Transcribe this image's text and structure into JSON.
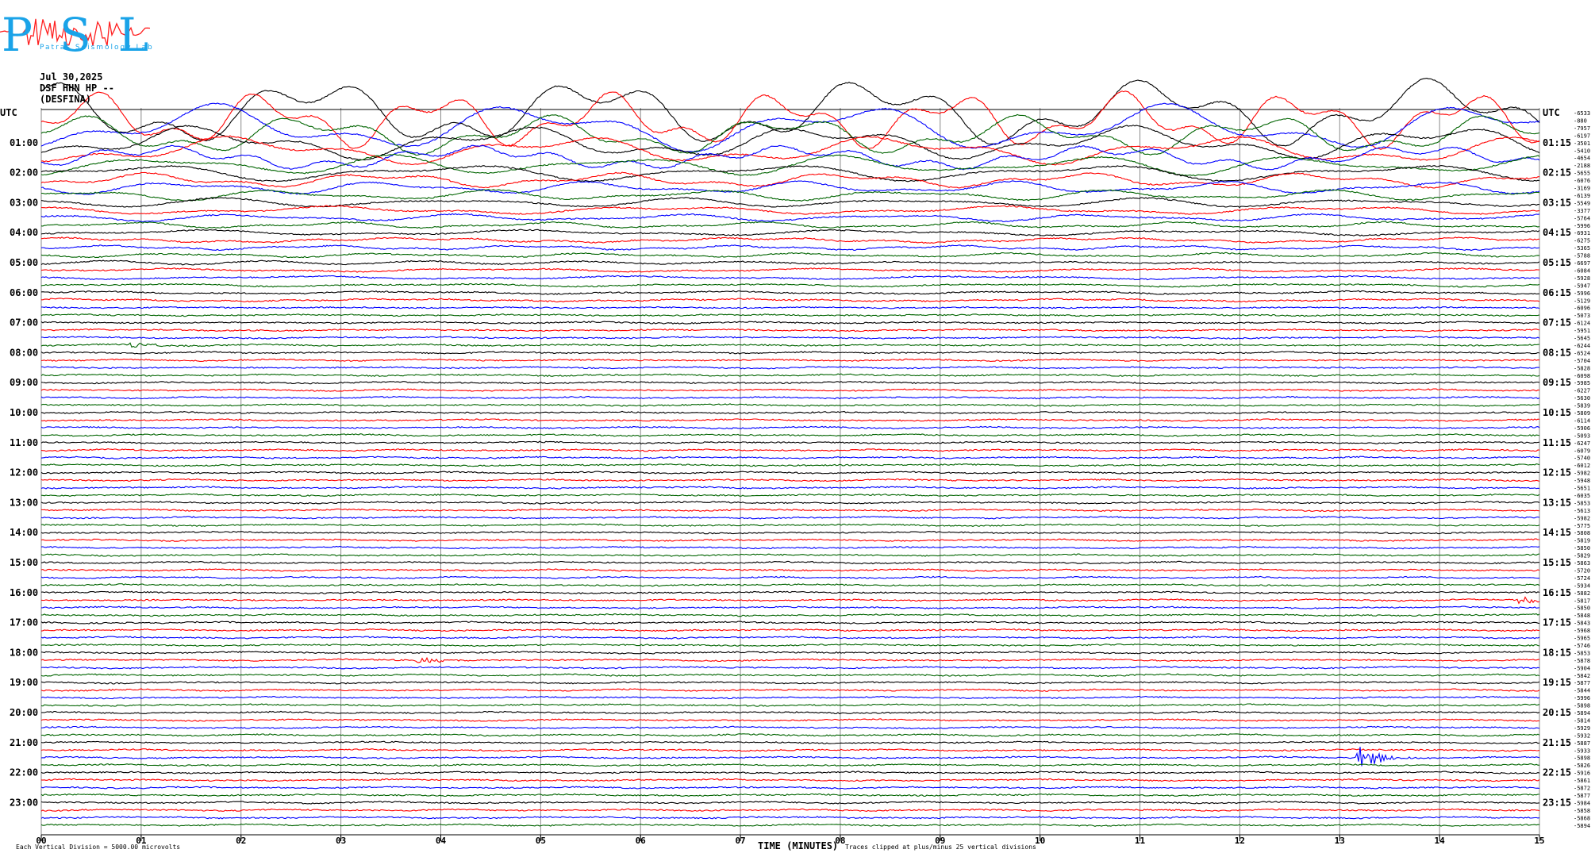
{
  "header": {
    "date": "Jul 30,2025",
    "channel": "DSF HHN HP --",
    "network": "(DESFINA)"
  },
  "logo": {
    "letters": "PSL",
    "subtitle": "Patras Seismology Lab",
    "color_letters": "#1aa3e8",
    "color_wave": "#ff2020"
  },
  "chart_data": {
    "type": "helicorder",
    "left_axis_title": "UTC",
    "right_axis_title": "UTC",
    "left_time_labels": [
      "01:00",
      "02:00",
      "03:00",
      "04:00",
      "05:00",
      "06:00",
      "07:00",
      "08:00",
      "09:00",
      "10:00",
      "11:00",
      "12:00",
      "13:00",
      "14:00",
      "15:00",
      "16:00",
      "17:00",
      "18:00",
      "19:00",
      "20:00",
      "21:00",
      "22:00",
      "23:00"
    ],
    "right_time_labels": [
      "01:15",
      "02:15",
      "03:15",
      "04:15",
      "05:15",
      "06:15",
      "07:15",
      "08:15",
      "09:15",
      "10:15",
      "11:15",
      "12:15",
      "13:15",
      "14:15",
      "15:15",
      "16:15",
      "17:15",
      "18:15",
      "19:15",
      "20:15",
      "21:15",
      "22:15",
      "23:15"
    ],
    "x_tick_labels": [
      "00",
      "01",
      "02",
      "03",
      "04",
      "05",
      "06",
      "07",
      "08",
      "09",
      "10",
      "11",
      "12",
      "13",
      "14",
      "15"
    ],
    "xlabel": "TIME (MINUTES)",
    "xlim": [
      0,
      15
    ],
    "trace_count": 96,
    "trace_interval_minutes": 15,
    "trace_colors": [
      "#000000",
      "#ff0000",
      "#0000ff",
      "#006400"
    ],
    "trace_offsets": [
      "-6533",
      "-880",
      "-7957",
      "-6197",
      "-3501",
      "-5410",
      "-4654",
      "-2188",
      "-5655",
      "-6076",
      "-3169",
      "-6139",
      "-5549",
      "-3377",
      "-5764",
      "-5996",
      "-6931",
      "-6275",
      "-5365",
      "-5788",
      "-6697",
      "-6084",
      "-5928",
      "-5947",
      "-5996",
      "-5129",
      "-6096",
      "-5073",
      "-6124",
      "-5951",
      "-5645",
      "-6244",
      "-6524",
      "-5704",
      "-5828",
      "-6098",
      "-5985",
      "-6227",
      "-5630",
      "-5839",
      "-5809",
      "-6114",
      "-5906",
      "-5093",
      "-6247",
      "-6079",
      "-5740",
      "-6012",
      "-5982",
      "-5948",
      "-5651",
      "-6035",
      "-5853",
      "-5613",
      "-5982",
      "-5775",
      "-5808",
      "-5819",
      "-5850",
      "-5829",
      "-5863",
      "-5720",
      "-5724",
      "-5934",
      "-5882",
      "-5817",
      "-5850",
      "-5848",
      "-5843",
      "-5968",
      "-5965",
      "-5746",
      "-5853",
      "-5878",
      "-5904",
      "-5842",
      "-5877",
      "-5844",
      "-5996",
      "-5898",
      "-5894",
      "-5814",
      "-5929",
      "-5932",
      "-5887",
      "-5933",
      "-5898",
      "-5826",
      "-5916",
      "-5861",
      "-5872",
      "-5877",
      "-5984",
      "-5858",
      "-5868",
      "-5894"
    ],
    "events": [
      {
        "trace": 31,
        "minute": 0.9,
        "amplitude": "small"
      },
      {
        "trace": 65,
        "minute": 14.8,
        "amplitude": "small"
      },
      {
        "trace": 73,
        "minute": 3.8,
        "amplitude": "small"
      },
      {
        "trace": 86,
        "minute": 13.2,
        "amplitude": "medium"
      }
    ],
    "clipping_note": "Traces clipped at plus/minus 25 vertical divisions",
    "scale_note": "Each Vertical Division = 5000.00 microvolts"
  }
}
